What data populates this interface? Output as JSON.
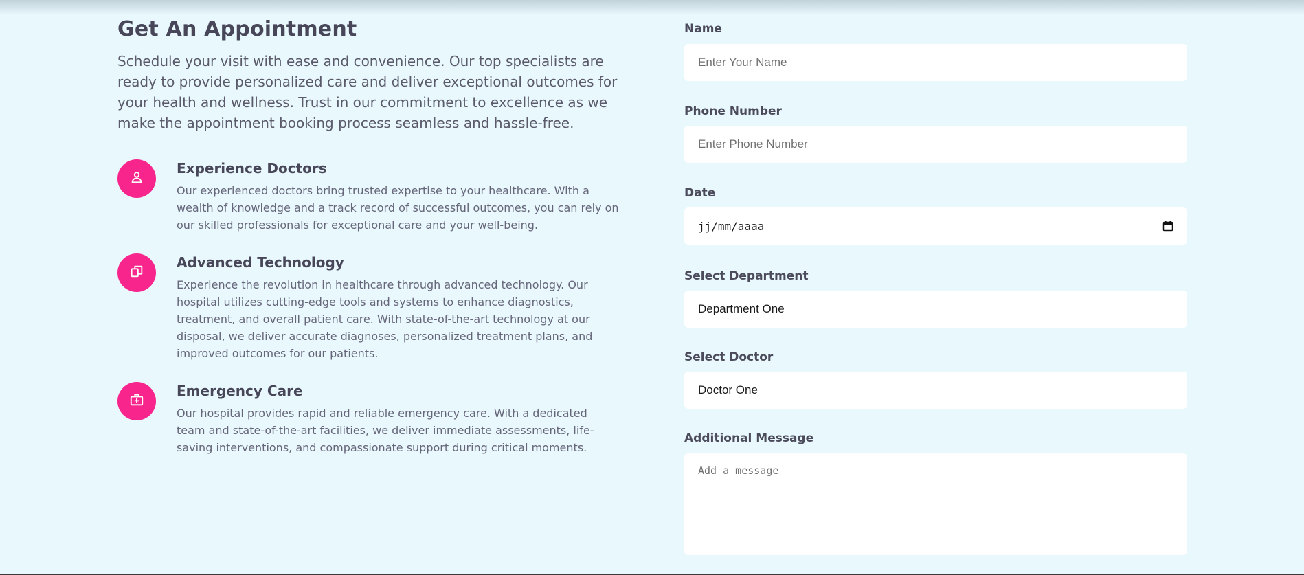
{
  "appointment": {
    "title": "Get An Appointment",
    "intro": "Schedule your visit with ease and convenience. Our top specialists are ready to provide personalized care and deliver exceptional outcomes for your health and wellness. Trust in our commitment to excellence as we make the appointment booking process seamless and hassle-free.",
    "features": [
      {
        "icon": "user-icon",
        "title": "Experience Doctors",
        "description": "Our experienced doctors bring trusted expertise to your healthcare. With a wealth of knowledge and a track record of successful outcomes, you can rely on our skilled professionals for exceptional care and your well-being."
      },
      {
        "icon": "copy-icon",
        "title": "Advanced Technology",
        "description": "Experience the revolution in healthcare through advanced technology. Our hospital utilizes cutting-edge tools and systems to enhance diagnostics, treatment, and overall patient care. With state-of-the-art technology at our disposal, we deliver accurate diagnoses, personalized treatment plans, and improved outcomes for our patients."
      },
      {
        "icon": "medical-kit-icon",
        "title": "Emergency Care",
        "description": "Our hospital provides rapid and reliable emergency care. With a dedicated team and state-of-the-art facilities, we deliver immediate assessments, life-saving interventions, and compassionate support during critical moments."
      }
    ]
  },
  "form": {
    "name": {
      "label": "Name",
      "placeholder": "Enter Your Name"
    },
    "phone": {
      "label": "Phone Number",
      "placeholder": "Enter Phone Number"
    },
    "date": {
      "label": "Date",
      "placeholder": "jj/mm/aaaa",
      "icon": "calendar-icon"
    },
    "department": {
      "label": "Select Department",
      "value": "Department One"
    },
    "doctor": {
      "label": "Select Doctor",
      "value": "Doctor One"
    },
    "message": {
      "label": "Additional Message",
      "placeholder": "Add a message"
    }
  },
  "colors": {
    "background": "#e9f8fd",
    "accent": "#f7258c",
    "heading": "#474759",
    "body_text": "#66667a",
    "field_background": "#ffffff"
  }
}
